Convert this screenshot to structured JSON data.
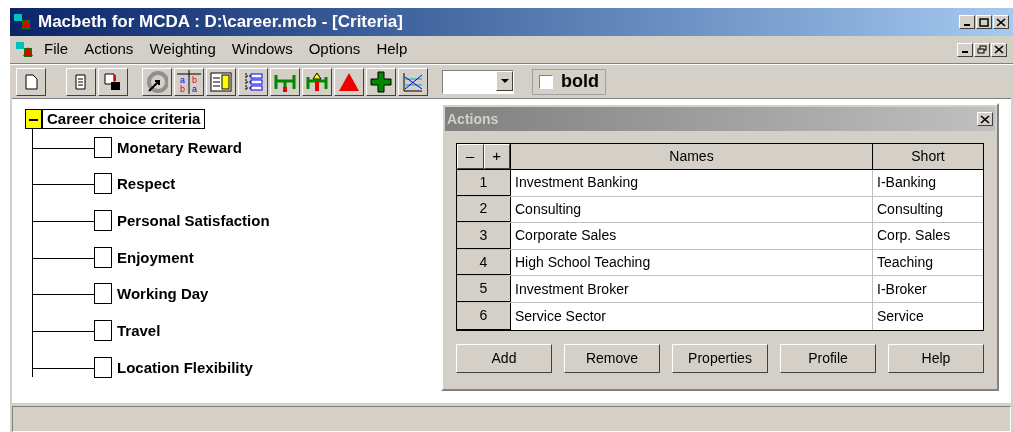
{
  "window": {
    "title": "Macbeth for MCDA : D:\\career.mcb - [Criteria]"
  },
  "menu": [
    "File",
    "Actions",
    "Weighting",
    "Windows",
    "Options",
    "Help"
  ],
  "toolbar": {
    "letters_icon": [
      "a",
      "b",
      "b",
      "a"
    ],
    "bold_checkbox": {
      "label": "bold",
      "checked": false
    }
  },
  "tree": {
    "label": "Career choice criteria",
    "expanded": true,
    "children": [
      {
        "label": "Monetary Reward",
        "checked": false
      },
      {
        "label": "Respect",
        "checked": false
      },
      {
        "label": "Personal Satisfaction",
        "checked": false
      },
      {
        "label": "Enjoyment",
        "checked": false
      },
      {
        "label": "Working Day",
        "checked": false
      },
      {
        "label": "Travel",
        "checked": false
      },
      {
        "label": "Location Flexibility",
        "checked": false
      }
    ]
  },
  "actions_dialog": {
    "title": "Actions",
    "header_buttons": [
      "–",
      "+"
    ],
    "columns": [
      "Names",
      "Short"
    ],
    "rows": [
      {
        "number": "1",
        "name": "Investment Banking",
        "short": "I-Banking"
      },
      {
        "number": "2",
        "name": "Consulting",
        "short": "Consulting"
      },
      {
        "number": "3",
        "name": "Corporate Sales",
        "short": "Corp. Sales"
      },
      {
        "number": "4",
        "name": "High School Teaching",
        "short": "Teaching"
      },
      {
        "number": "5",
        "name": "Investment Broker",
        "short": "I-Broker"
      },
      {
        "number": "6",
        "name": "Service Sector",
        "short": "Service"
      }
    ],
    "buttons": [
      "Add",
      "Remove",
      "Properties",
      "Profile",
      "Help"
    ]
  }
}
